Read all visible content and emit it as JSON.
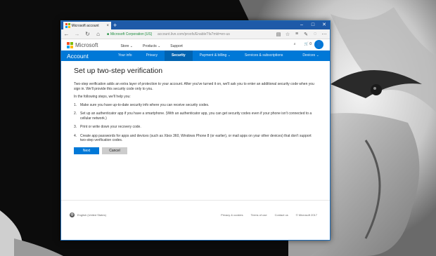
{
  "browser": {
    "tab_title": "Microsoft account",
    "tab_close": "×",
    "new_tab": "+",
    "url_cert": "Microsoft Corporation [US]",
    "url_path": "account.live.com/proofs/EnableTfa?mkt=en-us",
    "window_controls": [
      "–",
      "□",
      "✕"
    ]
  },
  "ms_header": {
    "brand": "Microsoft",
    "links": [
      "Store ⌄",
      "Products ⌄",
      "Support"
    ],
    "search": "⌕",
    "cart": "🛒 0"
  },
  "account_nav": {
    "title": "Account",
    "items": [
      {
        "label": "Your info",
        "active": false
      },
      {
        "label": "Privacy",
        "active": false
      },
      {
        "label": "Security",
        "active": true
      },
      {
        "label": "Payment & billing ⌄",
        "active": false
      },
      {
        "label": "Services & subscriptions",
        "active": false
      },
      {
        "label": "Devices ⌄",
        "active": false
      }
    ]
  },
  "page": {
    "title": "Set up two-step verification",
    "intro_1": "Two-step verification adds an extra layer of protection to your account. After you've turned it on, we'll ask you to enter an additional security code when you sign in. We'll provide this security code only to you.",
    "intro_2": "In the following steps, we'll help you:",
    "steps": [
      {
        "num": "1.",
        "text": "Make sure you have up-to-date security info where you can receive security codes."
      },
      {
        "num": "2.",
        "text": "Set up an authenticator app if you have a smartphone. (With an authenticator app, you can get security codes even if your phone isn't connected to a cellular network.)"
      },
      {
        "num": "3.",
        "text": "Print or write down your recovery code."
      },
      {
        "num": "4.",
        "text": "Create app passwords for apps and devices (such as Xbox 360, Windows Phone 8 (or earlier), or mail apps on your other devices) that don't support two-step verification codes."
      }
    ],
    "next_label": "Next",
    "cancel_label": "Cancel"
  },
  "footer": {
    "locale": "English (United States)",
    "links": [
      "Privacy & cookies",
      "Terms of use",
      "Contact us",
      "© Microsoft 2017"
    ]
  },
  "colors": {
    "accent": "#0078d7",
    "titlebar": "#1e5aa8",
    "ms_red": "#f25022",
    "ms_green": "#7fba00",
    "ms_blue": "#00a4ef",
    "ms_yellow": "#ffb900"
  }
}
